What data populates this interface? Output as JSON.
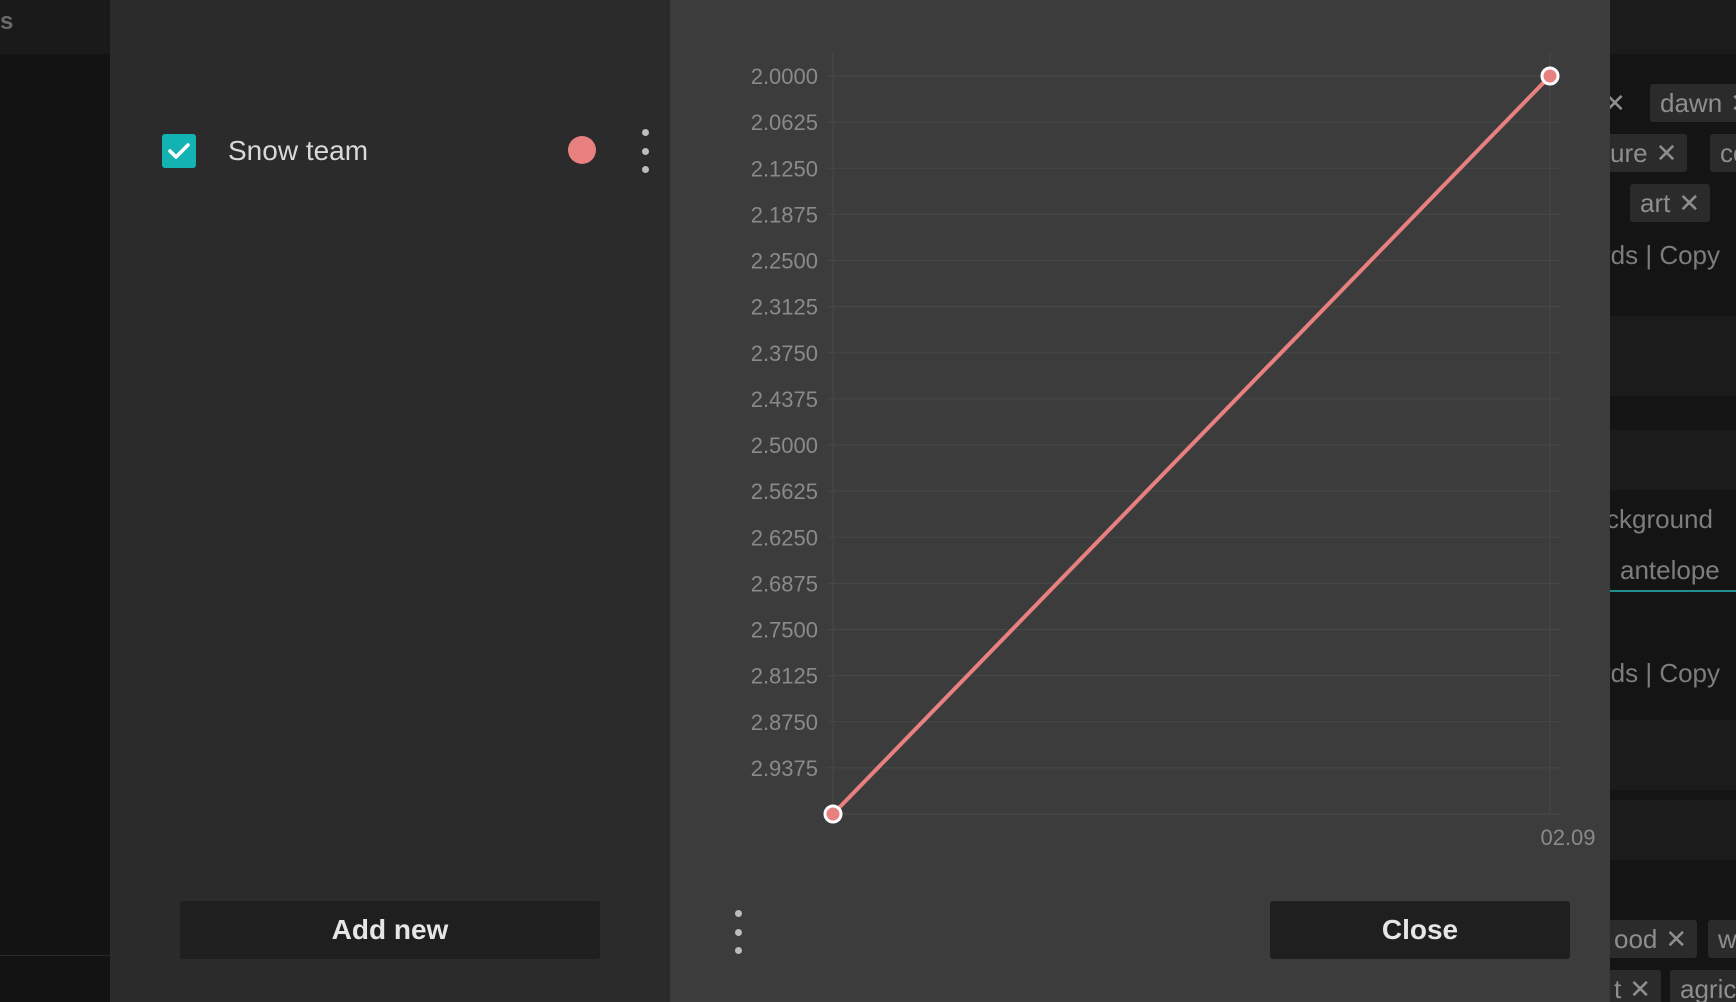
{
  "background": {
    "left_fragment": "s",
    "chips": [
      {
        "label": "dawn",
        "close": "✕"
      },
      {
        "label": "ure",
        "close": "✕"
      },
      {
        "label": "co",
        "close": ""
      },
      {
        "label": "art",
        "close": "✕"
      },
      {
        "label": "ood",
        "close": "✕"
      },
      {
        "label": "w",
        "close": ""
      },
      {
        "label": "t",
        "close": "✕"
      },
      {
        "label": "agric",
        "close": ""
      }
    ],
    "texts": [
      "rds | Copy",
      "ckground",
      "antelope",
      "rds | Copy"
    ]
  },
  "teams": [
    {
      "name": "Snow team",
      "checked": true,
      "color": "#e88080"
    }
  ],
  "buttons": {
    "add_new": "Add new",
    "close": "Close"
  },
  "chart_data": {
    "type": "line",
    "title": "",
    "xlabel": "",
    "ylabel": "",
    "y_axis_inverted": true,
    "ylim": [
      2.0,
      3.0
    ],
    "y_ticks": [
      "2.0000",
      "2.0625",
      "2.1250",
      "2.1875",
      "2.2500",
      "2.3125",
      "2.3750",
      "2.4375",
      "2.5000",
      "2.5625",
      "2.6250",
      "2.6875",
      "2.7500",
      "2.8125",
      "2.8750",
      "2.9375"
    ],
    "x_tick_labels": [
      "",
      "02.09"
    ],
    "grid": true,
    "series": [
      {
        "color": "#e88080",
        "x": [
          "",
          "02.09"
        ],
        "y": [
          3.0,
          2.0
        ]
      }
    ]
  }
}
